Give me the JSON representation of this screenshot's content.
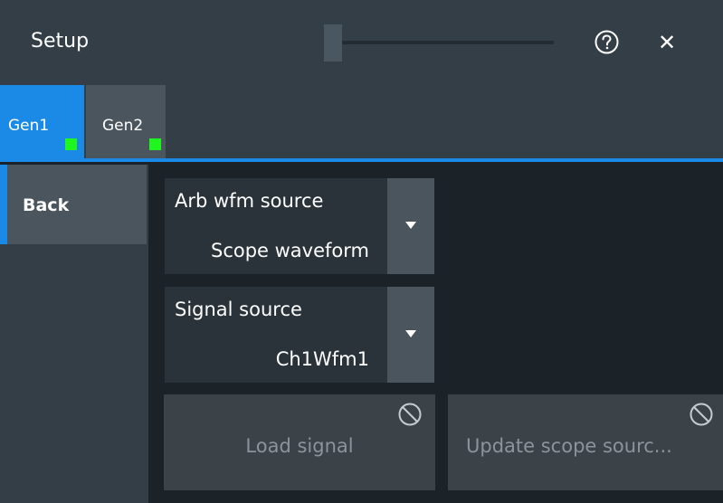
{
  "header": {
    "title": "Setup",
    "icons": [
      "help-icon",
      "close-icon"
    ],
    "close_glyph": "✕"
  },
  "tabs": [
    {
      "label": "Gen1",
      "active": true,
      "indicator_color": "#1ff51f"
    },
    {
      "label": "Gen2",
      "active": false,
      "indicator_color": "#1ff51f"
    }
  ],
  "sidebar": {
    "back_label": "Back"
  },
  "form": {
    "arb_wfm_source": {
      "label": "Arb wfm source",
      "value": "Scope waveform"
    },
    "signal_source": {
      "label": "Signal source",
      "value": "Ch1Wfm1"
    },
    "load_signal_label": "Load signal",
    "update_scope_label": "Update scope sourc..."
  },
  "colors": {
    "accent": "#1b8ae6",
    "background": "#1b2228",
    "panel": "#343e46",
    "indicator": "#1ff51f",
    "disabled_text": "#8b949a"
  }
}
